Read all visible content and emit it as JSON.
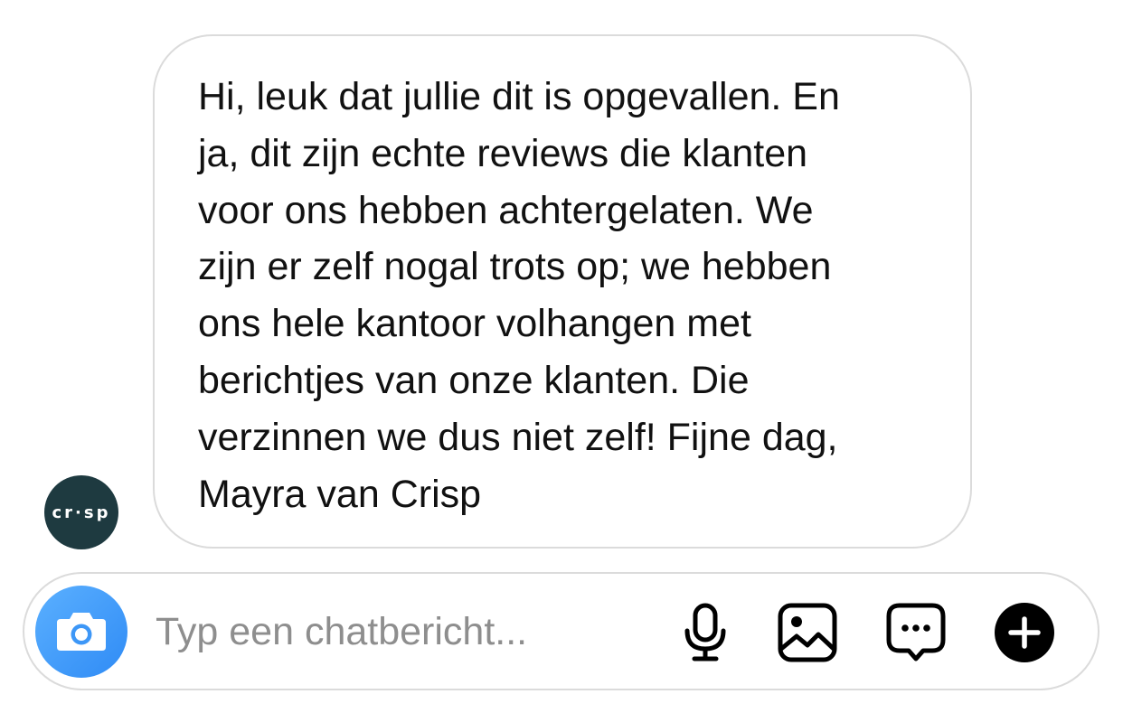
{
  "conversation": {
    "avatar": {
      "text": "cr·sp",
      "color": "#1e3a40"
    },
    "message": {
      "text": "Hi, leuk dat jullie dit is opgevallen. En\nja, dit zijn echte reviews die klanten\nvoor ons hebben achtergelaten. We\nzijn er zelf nogal trots op; we hebben\nons hele kantoor volhangen met\nberichtjes van onze klanten. Die\nverzinnen we dus niet zelf! Fijne dag,\nMayra van Crisp"
    }
  },
  "composer": {
    "placeholder": "Typ een chatbericht...",
    "camera_button": {
      "icon": "camera-icon",
      "color": "#3d97f7"
    },
    "mic_button": {
      "icon": "microphone-icon"
    },
    "image_button": {
      "icon": "image-icon"
    },
    "sticker_button": {
      "icon": "chat-bubble-icon"
    },
    "add_button": {
      "icon": "plus-icon"
    }
  }
}
